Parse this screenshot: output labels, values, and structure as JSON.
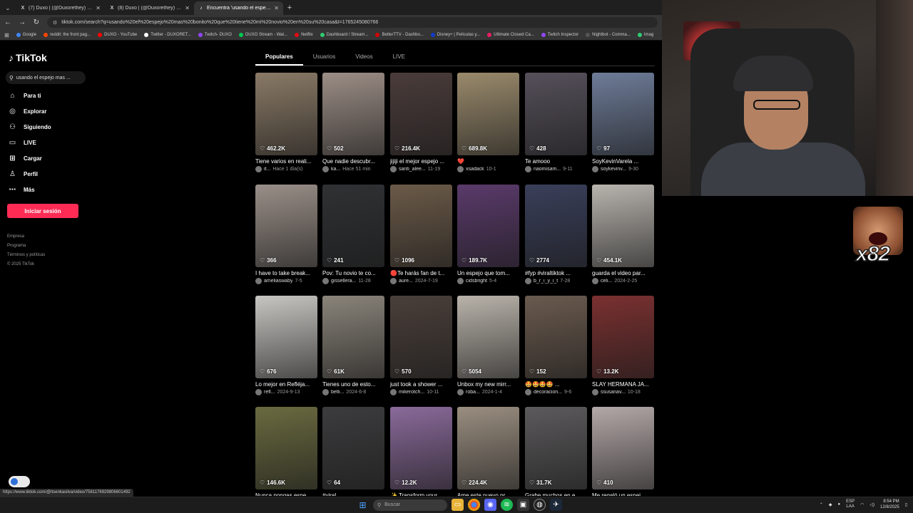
{
  "browser": {
    "tabs": [
      {
        "title": "(7) Duxo | (@Duxorethey) / X",
        "icon": "X",
        "active": false
      },
      {
        "title": "(8) Duxo | (@Duxorethey) / X",
        "icon": "X",
        "active": false
      },
      {
        "title": "Encuentra 'usando el espejo m...",
        "icon": "♪",
        "active": true
      }
    ],
    "url": "tiktok.com/search?q=usando%20el%20espejo%20mas%20bonito%20que%20tiene%20mi%20novio%20en%20su%20casa&t=1765245080766",
    "bookmarks": [
      {
        "label": "Google",
        "color": "#4285f4"
      },
      {
        "label": "reddit: the front pag...",
        "color": "#ff4500"
      },
      {
        "label": "DUXO - YouTube",
        "color": "#ff0000"
      },
      {
        "label": "Twitter - DUXORET...",
        "color": "#ffffff"
      },
      {
        "label": "Twitch- DUXO",
        "color": "#9146ff"
      },
      {
        "label": "DUXO Stream - Wat...",
        "color": "#00c853"
      },
      {
        "label": "Netflix",
        "color": "#e50914"
      },
      {
        "label": "Dashboard / Stream...",
        "color": "#2ecc71"
      },
      {
        "label": "BetterTTV - Dashbo...",
        "color": "#d50000"
      },
      {
        "label": "Disney+ | Películas y...",
        "color": "#113ccf"
      },
      {
        "label": "Ultimate Closed Ca...",
        "color": "#e91e63"
      },
      {
        "label": "Twitch Inspector",
        "color": "#9146ff"
      },
      {
        "label": "Nightbot - Comma...",
        "color": "#555555"
      },
      {
        "label": "Imag",
        "color": "#2ecc71"
      }
    ]
  },
  "sidebar": {
    "logo": "TikTok",
    "search_value": "usando el espejo mas ...",
    "nav": [
      {
        "label": "Para ti",
        "icon": "⌂"
      },
      {
        "label": "Explorar",
        "icon": "◎"
      },
      {
        "label": "Siguiendo",
        "icon": "⚇"
      },
      {
        "label": "LIVE",
        "icon": "▭"
      },
      {
        "label": "Cargar",
        "icon": "⊞"
      },
      {
        "label": "Perfil",
        "icon": "♙"
      },
      {
        "label": "Más",
        "icon": "⋯"
      }
    ],
    "login_label": "Iniciar sesión",
    "footer": [
      "Empresa",
      "Programa",
      "Términos y políticas",
      "© 2025 TikTok"
    ]
  },
  "filter_tabs": [
    "Populares",
    "Usuarios",
    "Videos",
    "LIVE"
  ],
  "videos": [
    {
      "likes": "462.2K",
      "caption": "Tiene varios en reali...",
      "author": "it...",
      "date": "Hace 1 día(s)",
      "bg": "#8a7a66"
    },
    {
      "likes": "502",
      "caption": "Que nadie descubr...",
      "author": "ka...",
      "date": "Hace 51 min",
      "bg": "#9c8e86"
    },
    {
      "likes": "216.4K",
      "caption": "jijiji el mejor espejo ...",
      "author": "santi_alee...",
      "date": "11-19",
      "bg": "#4a3c3a"
    },
    {
      "likes": "689.8K",
      "caption": "❤️",
      "author": "xsadack",
      "date": "10-1",
      "bg": "#9a8a6c"
    },
    {
      "likes": "428",
      "caption": "Te amooo",
      "author": "naomisam...",
      "date": "9-11",
      "bg": "#55505a"
    },
    {
      "likes": "97",
      "caption": "SoyKevinVarela ...",
      "author": "soykevinv...",
      "date": "9-30",
      "bg": "#6e7c98"
    },
    {
      "likes": "366",
      "caption": "I have to take break...",
      "author": "ameliaswaby",
      "date": "7-5",
      "bg": "#9a8f88"
    },
    {
      "likes": "241",
      "caption": "Pov: Tu novio te co...",
      "author": "gissellera...",
      "date": "11-28",
      "bg": "#2f3133"
    },
    {
      "likes": "1096",
      "caption": "🔴Te harás fan de t...",
      "author": "aure...",
      "date": "2024-7-19",
      "bg": "#6b5a48"
    },
    {
      "likes": "189.7K",
      "caption": "Un espejo que tom...",
      "author": "cidsbright",
      "date": "5-4",
      "bg": "#5a3a6a"
    },
    {
      "likes": "2774",
      "caption": "#fyp #viraltiktok ...",
      "author": "b_r_i_y_i_t",
      "date": "7-28",
      "bg": "#3a3f5a"
    },
    {
      "likes": "454.1K",
      "caption": "guarda el video par...",
      "author": "celi...",
      "date": "2024-2-25",
      "bg": "#b8b4ae"
    },
    {
      "likes": "676",
      "caption": "Lo mejor en Refléja...",
      "author": "refl...",
      "date": "2024-9-13",
      "bg": "#c8c6c2"
    },
    {
      "likes": "61K",
      "caption": "Tienes uno de esto...",
      "author": "belli...",
      "date": "2024-6-8",
      "bg": "#8a847a"
    },
    {
      "likes": "570",
      "caption": "just took a shower ...",
      "author": "mikerotch...",
      "date": "10-11",
      "bg": "#4a3f3a"
    },
    {
      "likes": "5054",
      "caption": "Unbox my new mirr...",
      "author": "roba...",
      "date": "2024-1-4",
      "bg": "#b9b3aa"
    },
    {
      "likes": "152",
      "caption": "🤩🤩🤩🤩 ...",
      "author": "decoracion...",
      "date": "9-6",
      "bg": "#6a5a4e"
    },
    {
      "likes": "13.2K",
      "caption": "SLAY HERMANA JA...",
      "author": "ssusanav...",
      "date": "10-18",
      "bg": "#7a3030"
    },
    {
      "likes": "146.6K",
      "caption": "Nunca pongas espe...",
      "author": "",
      "date": "",
      "bg": "#6a6a40"
    },
    {
      "likes": "64",
      "caption": "#viral",
      "author": "",
      "date": "",
      "bg": "#3c3c3e"
    },
    {
      "likes": "12.2K",
      "caption": "✨ Transform your ...",
      "author": "",
      "date": "",
      "bg": "#8a6a9a"
    },
    {
      "likes": "224.4K",
      "caption": "Ame este nuevo pr...",
      "author": "",
      "date": "",
      "bg": "#9a8e80"
    },
    {
      "likes": "31.7K",
      "caption": "Grabe muchos en e...",
      "author": "",
      "date": "",
      "bg": "#5c5a5c"
    },
    {
      "likes": "410",
      "caption": "Me regaló un espej...",
      "author": "",
      "date": "",
      "bg": "#b4a8a8"
    }
  ],
  "overlay": {
    "emote_count": "x82"
  },
  "status_url": "https://www.tiktok.com/@itsenkasilva/video/7581176929806601492",
  "taskbar": {
    "search_placeholder": "Buscar",
    "lang_line1": "ESP",
    "lang_line2": "LAA",
    "time": "8:54 PM",
    "date": "12/8/2025"
  }
}
